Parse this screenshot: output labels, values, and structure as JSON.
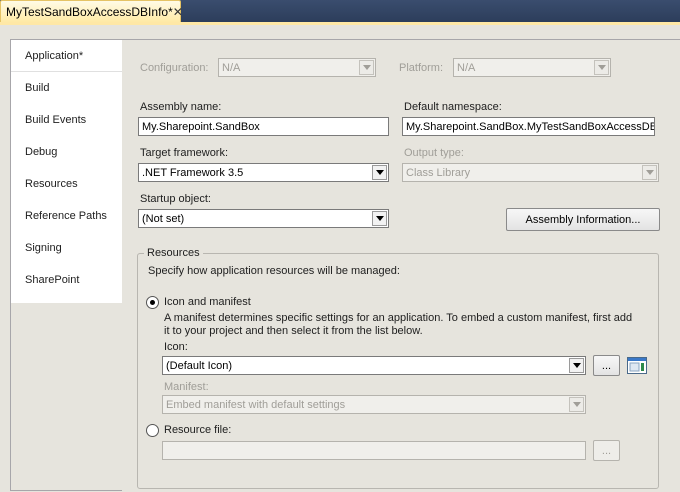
{
  "document_tab": {
    "title": "MyTestSandBoxAccessDBInfo*",
    "close_glyph": "✕"
  },
  "sidebar": {
    "items": [
      {
        "label": "Application*",
        "active": true
      },
      {
        "label": "Build"
      },
      {
        "label": "Build Events"
      },
      {
        "label": "Debug"
      },
      {
        "label": "Resources"
      },
      {
        "label": "Reference Paths"
      },
      {
        "label": "Signing"
      },
      {
        "label": "SharePoint"
      }
    ]
  },
  "config": {
    "configuration_label": "Configuration:",
    "configuration_value": "N/A",
    "platform_label": "Platform:",
    "platform_value": "N/A"
  },
  "assembly": {
    "name_label": "Assembly name:",
    "name_value": "My.Sharepoint.SandBox",
    "namespace_label": "Default namespace:",
    "namespace_value": "My.Sharepoint.SandBox.MyTestSandBoxAccessDBI"
  },
  "framework": {
    "label": "Target framework:",
    "value": ".NET Framework 3.5",
    "output_label": "Output type:",
    "output_value": "Class Library"
  },
  "startup": {
    "label": "Startup object:",
    "value": "(Not set)",
    "assembly_info_button": "Assembly Information..."
  },
  "resources": {
    "group_title": "Resources",
    "description": "Specify how application resources will be managed:",
    "icon_manifest_label": "Icon and manifest",
    "icon_manifest_help_1": "A manifest determines specific settings for an application. To embed a custom manifest, first add",
    "icon_manifest_help_2": "it to your project and then select it from the list below.",
    "icon_label": "Icon:",
    "icon_value": "(Default Icon)",
    "browse_label": "...",
    "manifest_label": "Manifest:",
    "manifest_value": "Embed manifest with default settings",
    "resource_file_label": "Resource file:",
    "resource_file_value": "",
    "resource_browse_label": "..."
  },
  "colors": {
    "accent_tab": "#ffe8a6",
    "chrome": "#2b3c59",
    "surface": "#e6e4dd"
  }
}
